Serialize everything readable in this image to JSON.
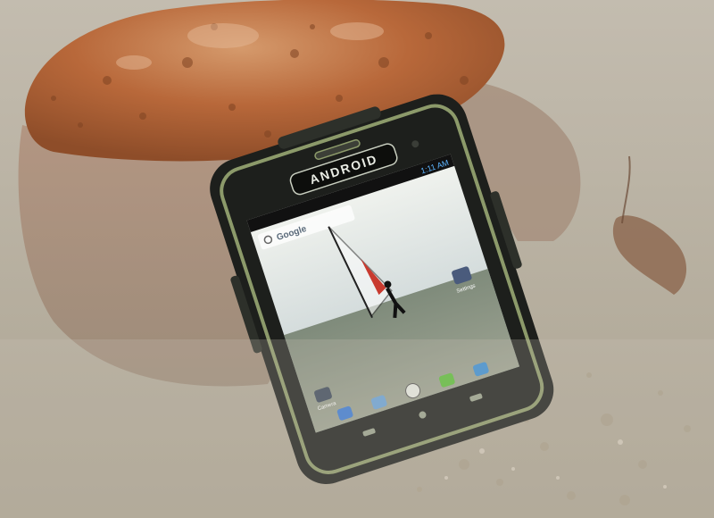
{
  "phone": {
    "brand_logo": "ANDROID",
    "status_time": "1:11 AM",
    "search_label": "Google",
    "app_labels": {
      "camera": "Camera",
      "settings": "Settings"
    }
  },
  "colors": {
    "water": "#b9b2a4",
    "rock": "#b8683a",
    "phone_body": "#1d1f1c",
    "phone_trim": "#8c9a6a",
    "screen_sky": "#dfe6e6",
    "sail_accent": "#c83a2f"
  }
}
